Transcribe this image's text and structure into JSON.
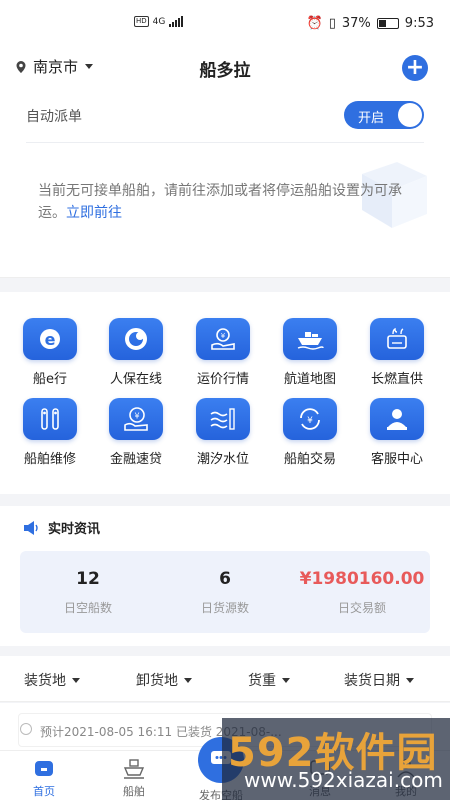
{
  "status": {
    "network": "4G",
    "hd": "HD",
    "battery": "37%",
    "time": "9:53"
  },
  "header": {
    "city": "南京市",
    "title": "船多拉",
    "add_label": "+"
  },
  "dispatch": {
    "label": "自动派单",
    "toggle_label": "开启",
    "notice": "当前无可接单船舶，请前往添加或者将停运船舶设置为可承运。",
    "link": "立即前往"
  },
  "services": [
    {
      "label": "船e行",
      "icon": "e-icon"
    },
    {
      "label": "人保在线",
      "icon": "insurance-icon"
    },
    {
      "label": "运价行情",
      "icon": "freight-price-icon"
    },
    {
      "label": "航道地图",
      "icon": "ship-map-icon"
    },
    {
      "label": "长燃直供",
      "icon": "fuel-icon"
    },
    {
      "label": "船舶维修",
      "icon": "repair-icon"
    },
    {
      "label": "金融速贷",
      "icon": "loan-icon"
    },
    {
      "label": "潮汐水位",
      "icon": "tide-icon"
    },
    {
      "label": "船舶交易",
      "icon": "trade-icon"
    },
    {
      "label": "客服中心",
      "icon": "service-icon"
    }
  ],
  "news": {
    "title": "实时资讯",
    "stats": [
      {
        "value": "12",
        "label": "日空船数"
      },
      {
        "value": "6",
        "label": "日货源数"
      },
      {
        "value": "¥1980160.00",
        "label": "日交易额"
      }
    ]
  },
  "filters": [
    "装货地",
    "卸货地",
    "货重",
    "装货日期"
  ],
  "listing": {
    "text": "预计2021-08-05 16:11   已装货      2021-08-..."
  },
  "tabs": [
    {
      "label": "首页",
      "active": true
    },
    {
      "label": "船舶",
      "active": false
    },
    {
      "label": "发布空船",
      "active": false
    },
    {
      "label": "消息",
      "active": false
    },
    {
      "label": "我的",
      "active": false
    }
  ],
  "watermark": {
    "brand": "592软件园",
    "url": "www.592xiazai.com"
  },
  "colors": {
    "primary": "#2f6fe0",
    "price": "#e85a5a"
  }
}
